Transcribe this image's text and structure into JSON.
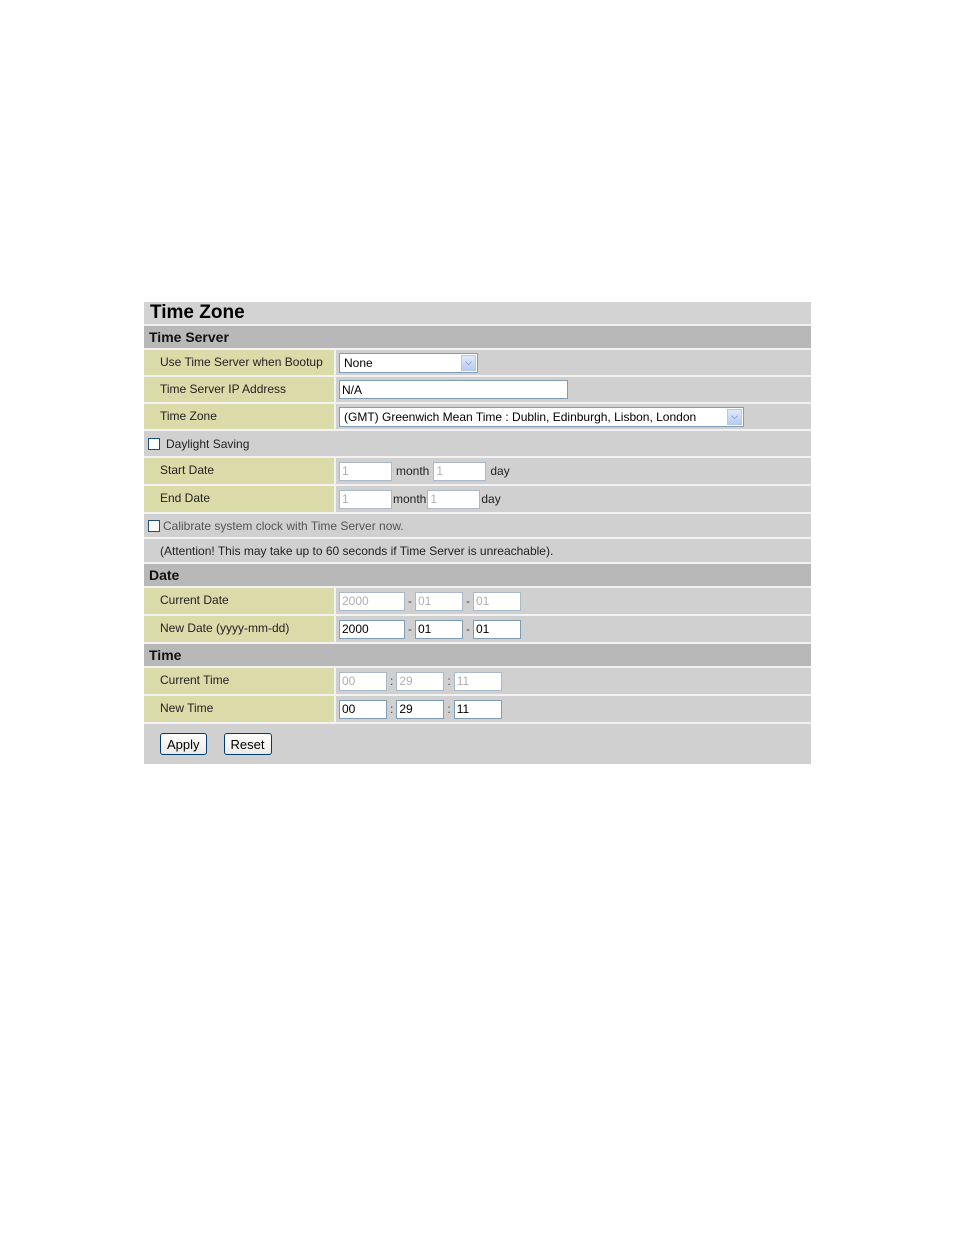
{
  "page": {
    "title": "Time Zone"
  },
  "time_server": {
    "heading": "Time Server",
    "use_time_server_label": "Use Time Server when Bootup",
    "use_time_server_value": "None",
    "ip_label": "Time Server IP Address",
    "ip_value": "N/A",
    "timezone_label": "Time Zone",
    "timezone_value": "(GMT) Greenwich Mean Time : Dublin, Edinburgh, Lisbon, London",
    "daylight_label": "Daylight Saving",
    "daylight_checked": false,
    "start_label": "Start Date",
    "start_month": "1",
    "start_day": "1",
    "end_label": "End Date",
    "end_month": "1",
    "end_day": "1",
    "month_word": "month",
    "day_word": "day",
    "calibrate_label": "Calibrate system clock with Time Server now.",
    "calibrate_checked": false,
    "attention": "(Attention! This may take up to 60 seconds if Time Server is unreachable)."
  },
  "date": {
    "heading": "Date",
    "current_label": "Current Date",
    "current_year": "2000",
    "current_month": "01",
    "current_day": "01",
    "new_label": "New Date (yyyy-mm-dd)",
    "new_year": "2000",
    "new_month": "01",
    "new_day": "01",
    "separator": "-"
  },
  "time": {
    "heading": "Time",
    "current_label": "Current Time",
    "current_hour": "00",
    "current_min": "29",
    "current_sec": "11",
    "new_label": "New Time",
    "new_hour": "00",
    "new_min": "29",
    "new_sec": "11",
    "separator": ":"
  },
  "buttons": {
    "apply": "Apply",
    "reset": "Reset"
  },
  "icons": {
    "dropdown": "chevron-down-icon"
  }
}
